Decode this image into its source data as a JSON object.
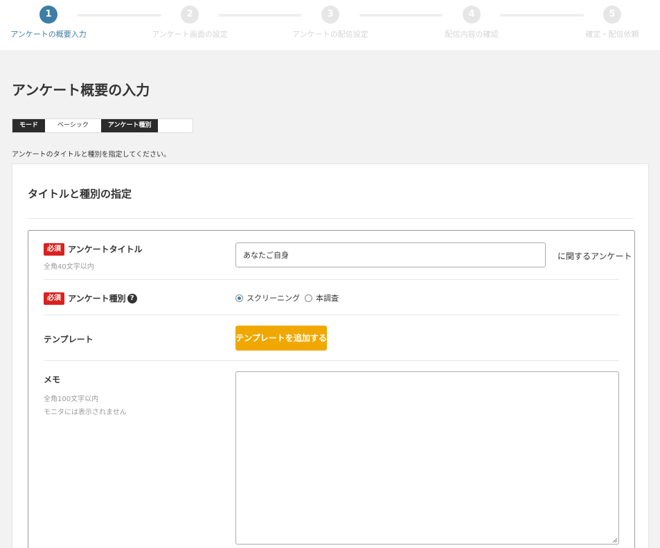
{
  "stepper": {
    "steps": [
      {
        "num": "1",
        "label": "アンケートの概要入力"
      },
      {
        "num": "2",
        "label": "アンケート画面の設定"
      },
      {
        "num": "3",
        "label": "アンケートの配信設定"
      },
      {
        "num": "4",
        "label": "配信内容の確認"
      },
      {
        "num": "5",
        "label": "確定・配信依頼"
      }
    ]
  },
  "page": {
    "title": "アンケート概要の入力",
    "instruction": "アンケートのタイトルと種別を指定してください。"
  },
  "modebar": {
    "mode_key": "モード",
    "mode_value": "ベーシック",
    "type_key": "アンケート種別",
    "type_value": ""
  },
  "card": {
    "title": "タイトルと種別の指定"
  },
  "form": {
    "required_badge": "必須",
    "survey_title": {
      "label": "アンケートタイトル",
      "hint": "全角40文字以内",
      "value": "あなたご自身",
      "suffix": "に関するアンケート"
    },
    "survey_type": {
      "label": "アンケート種別",
      "help": "?",
      "options": [
        "スクリーニング",
        "本調査"
      ],
      "selected": "スクリーニング"
    },
    "template": {
      "label": "テンプレート",
      "button": "テンプレートを追加する"
    },
    "memo": {
      "label": "メモ",
      "hint1": "全角100文字以内",
      "hint2": "モニタには表示されません",
      "value": ""
    }
  },
  "colors": {
    "accent": "#3d7ea6",
    "required": "#d9221f",
    "button": "#f0a800"
  }
}
